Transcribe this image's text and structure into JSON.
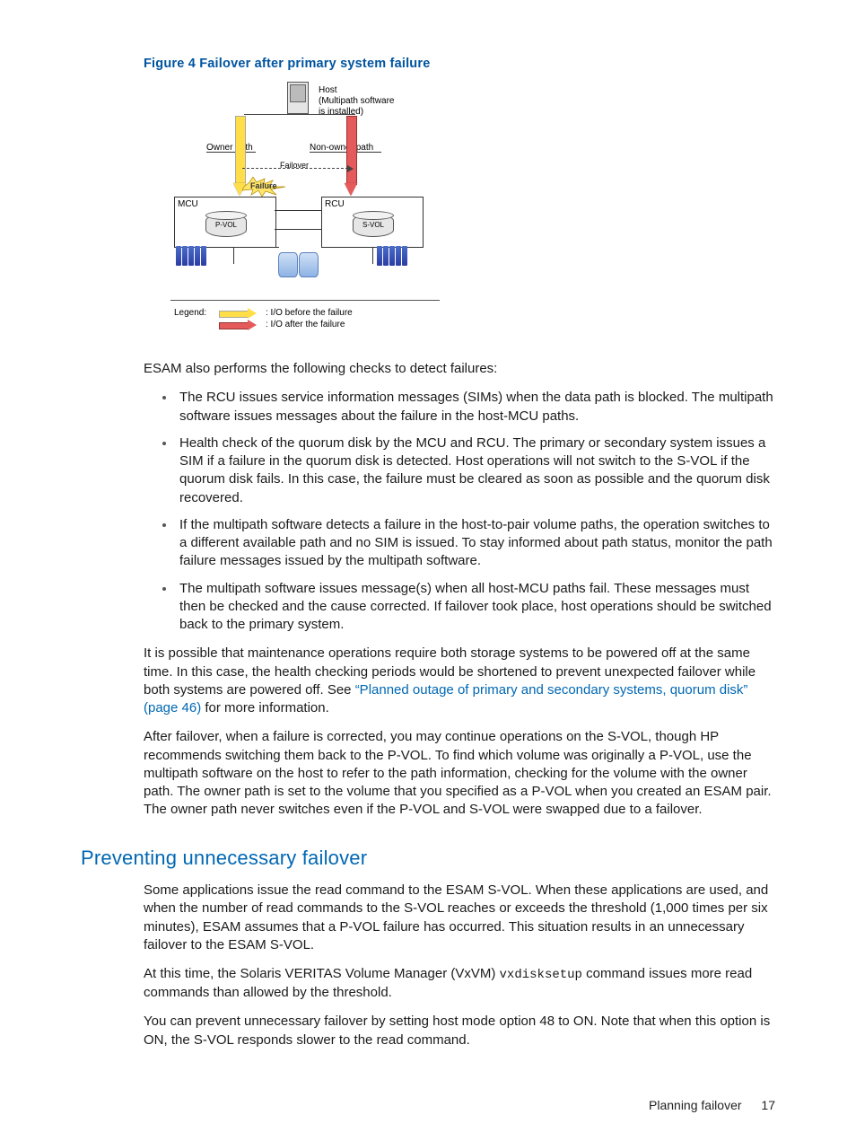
{
  "figure": {
    "caption": "Figure 4 Failover after primary system failure",
    "host_label": "Host\n(Multipath software\nis installed)",
    "owner_path": "Owner path",
    "nonowner_path": "Non-owner path",
    "failover": "Failover",
    "failure": "Failure",
    "mcu": "MCU",
    "rcu": "RCU",
    "pvol": "P-VOL",
    "svol": "S-VOL",
    "legend_key": "Legend:",
    "legend_before": ":  I/O before the failure",
    "legend_after": ":  I/O after the failure"
  },
  "intro": "ESAM also performs the following checks to detect failures:",
  "bullets": [
    "The RCU issues service information messages (SIMs) when the data path is blocked. The multipath software issues messages about the failure in the host-MCU paths.",
    "Health check of the quorum disk by the MCU and RCU. The primary or secondary system issues a SIM if a failure in the quorum disk is detected. Host operations will not switch to the S-VOL if the quorum disk fails. In this case, the failure must be cleared as soon as possible and the quorum disk recovered.",
    "If the multipath software detects a failure in the host-to-pair volume paths, the operation switches to a different available path and no SIM is issued. To stay informed about path status, monitor the path failure messages issued by the multipath software.",
    "The multipath software issues message(s) when all host-MCU paths fail. These messages must then be checked and the cause corrected. If failover took place, host operations should be switched back to the primary system."
  ],
  "maint_a": "It is possible that maintenance operations require both storage systems to be powered off at the same time. In this case, the health checking periods would be shortened to prevent unexpected failover while both systems are powered off. See ",
  "maint_link": "“Planned outage of primary and secondary systems, quorum disk” (page 46)",
  "maint_b": " for more information.",
  "after_failover": "After failover, when a failure is corrected, you may continue operations on the S-VOL, though HP recommends switching them back to the P-VOL. To find which volume was originally a P-VOL, use the multipath software on the host to refer to the path information, checking for the volume with the owner path. The owner path is set to the volume that you specified as a P-VOL when you created an ESAM pair. The owner path never switches even if the P-VOL and S-VOL were swapped due to a failover.",
  "section_heading": "Preventing unnecessary failover",
  "prev1": "Some applications issue the read command to the ESAM S-VOL. When these applications are used, and when the number of read commands to the S-VOL reaches or exceeds the threshold (1,000 times per six minutes), ESAM assumes that a P-VOL failure has occurred. This situation results in an unnecessary failover to the ESAM S-VOL.",
  "prev2_a": "At this time, the Solaris VERITAS Volume Manager (VxVM) ",
  "prev2_code": "vxdisksetup",
  "prev2_b": " command issues more read commands than allowed by the threshold.",
  "prev3": "You can prevent unnecessary failover by setting host mode option 48 to ON. Note that when this option is ON, the S-VOL responds slower to the read command.",
  "footer_text": "Planning failover",
  "page_number": "17"
}
